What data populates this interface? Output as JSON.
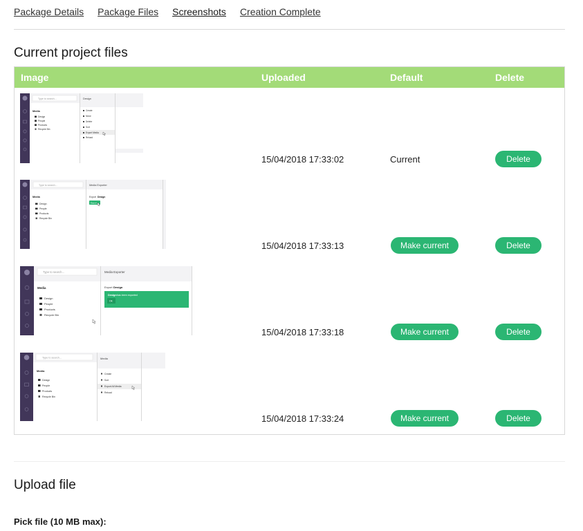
{
  "tabs": [
    {
      "label": "Package Details"
    },
    {
      "label": "Package Files"
    },
    {
      "label": "Screenshots",
      "active": true
    },
    {
      "label": "Creation Complete"
    }
  ],
  "section_title": "Current project files",
  "table": {
    "headers": {
      "image": "Image",
      "uploaded": "Uploaded",
      "default": "Default",
      "delete": "Delete"
    },
    "header_color": "#a3db78",
    "button_color": "#2bb673",
    "rows": [
      {
        "uploaded": "15/04/2018 17:33:02",
        "default_text": "Current",
        "delete_label": "Delete",
        "thumb": {
          "search_placeholder": "Type to search...",
          "panel_title": "Design",
          "tree_title": "Media",
          "tree_items": [
            "Design",
            "People",
            "Products",
            "Recycle Bin"
          ],
          "menu_items": [
            "Create",
            "Move",
            "Delete",
            "Sort",
            "Export Media",
            "Reload"
          ]
        }
      },
      {
        "uploaded": "15/04/2018 17:33:13",
        "make_current_label": "Make current",
        "delete_label": "Delete",
        "thumb": {
          "search_placeholder": "Type to search...",
          "panel_title": "Media Exporter",
          "tree_title": "Media",
          "tree_items": [
            "Design",
            "People",
            "Products",
            "Recycle Bin"
          ],
          "export_label": "Export",
          "export_target": "Design",
          "export_button": "Export"
        }
      },
      {
        "uploaded": "15/04/2018 17:33:18",
        "make_current_label": "Make current",
        "delete_label": "Delete",
        "thumb": {
          "search_placeholder": "Type to search...",
          "panel_title": "Media Exporter",
          "tree_title": "Media",
          "tree_items": [
            "Design",
            "People",
            "Products",
            "Recycle Bin"
          ],
          "export_label": "Export",
          "export_target": "Design",
          "exported_msg_bold": "Design",
          "exported_msg": "has been exported",
          "ok_button": "Ok"
        }
      },
      {
        "uploaded": "15/04/2018 17:33:24",
        "make_current_label": "Make current",
        "delete_label": "Delete",
        "thumb": {
          "search_placeholder": "Type to search...",
          "panel_title": "Media",
          "tree_title": "Media",
          "tree_items": [
            "Design",
            "People",
            "Products",
            "Recycle Bin"
          ],
          "menu_items": [
            "Create",
            "Sort",
            "Export All Media",
            "Reload"
          ]
        }
      }
    ]
  },
  "upload": {
    "title": "Upload file",
    "pick_label": "Pick file (10 MB max):"
  }
}
